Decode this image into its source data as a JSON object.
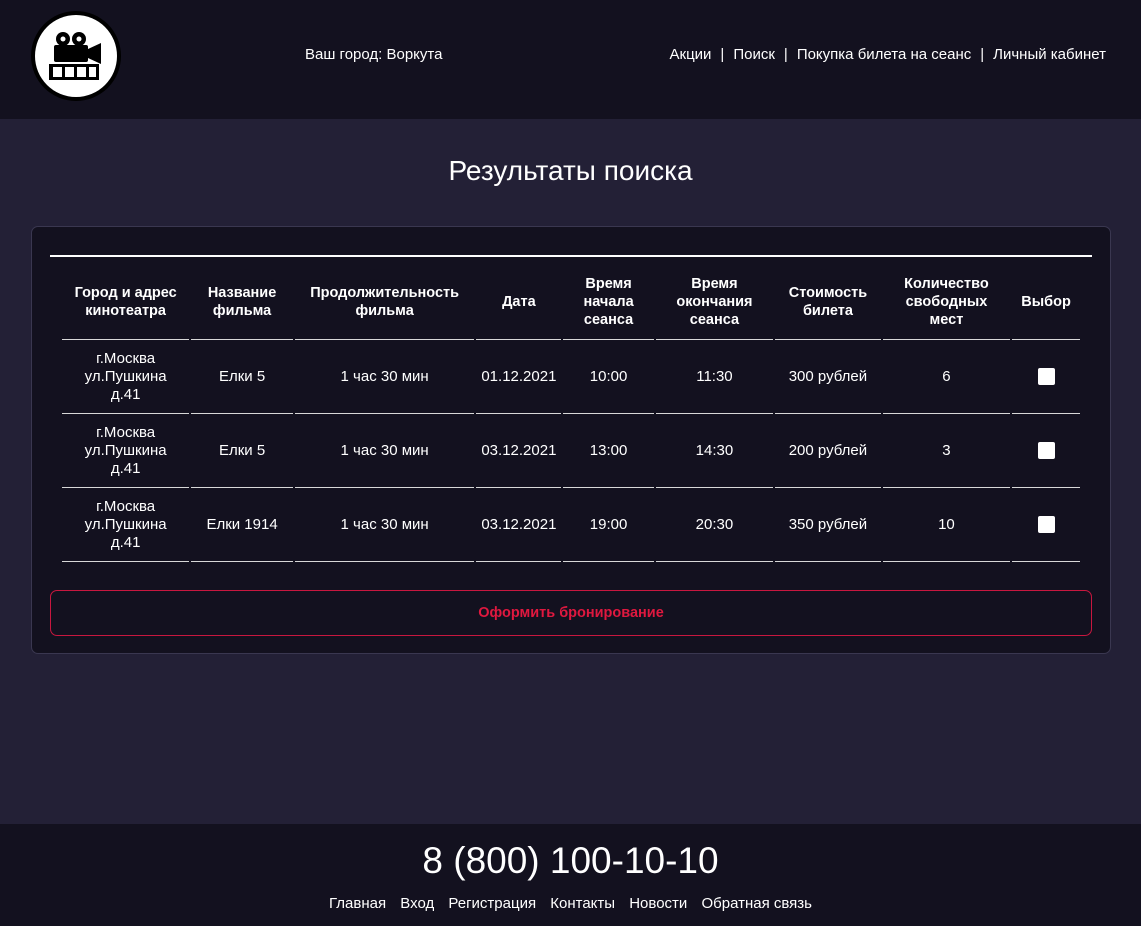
{
  "header": {
    "city": "Ваш город: Воркута",
    "nav": [
      "Акции",
      "Поиск",
      "Покупка билета на сеанс",
      "Личный кабинет"
    ],
    "separator": "|",
    "logo_icon": "film-camera-icon"
  },
  "page_title": "Результаты поиска",
  "table": {
    "headers": [
      "Город и адрес кинотеатра",
      "Название фильма",
      "Продолжительность фильма",
      "Дата",
      "Время начала сеанса",
      "Время окончания сеанса",
      "Стоимость билета",
      "Количество свободных мест",
      "Выбор"
    ],
    "rows": [
      {
        "address": [
          "г.Москва",
          "ул.Пушкина",
          "д.41"
        ],
        "film": "Елки 5",
        "duration": "1 час 30 мин",
        "date": "01.12.2021",
        "start": "10:00",
        "end": "11:30",
        "price": "300 рублей",
        "seats": "6",
        "selected": false
      },
      {
        "address": [
          "г.Москва",
          "ул.Пушкина",
          "д.41"
        ],
        "film": "Елки 5",
        "duration": "1 час 30 мин",
        "date": "03.12.2021",
        "start": "13:00",
        "end": "14:30",
        "price": "200 рублей",
        "seats": "3",
        "selected": false
      },
      {
        "address": [
          "г.Москва",
          "ул.Пушкина",
          "д.41"
        ],
        "film": "Елки 1914",
        "duration": "1 час 30 мин",
        "date": "03.12.2021",
        "start": "19:00",
        "end": "20:30",
        "price": "350 рублей",
        "seats": "10",
        "selected": false
      }
    ]
  },
  "book_button": "Оформить бронирование",
  "footer": {
    "phone": "8 (800) 100-10-10",
    "links": [
      "Главная",
      "Вход",
      "Регистрация",
      "Контакты",
      "Новости",
      "Обратная связь"
    ]
  },
  "colors": {
    "background": "#232036",
    "panel": "#13111f",
    "accent": "#e0183f"
  }
}
